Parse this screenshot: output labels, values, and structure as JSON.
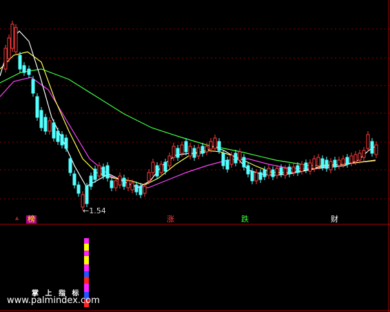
{
  "chart_data": [
    {
      "type": "candlestick",
      "panel": "price",
      "annotation": {
        "text": "←1.54",
        "value": 1.54
      },
      "colors": {
        "up": "#ff3b3b",
        "down": "#54ffff",
        "ma5": "#ffffff",
        "ma10": "#ffff55",
        "ma20": "#ff44ff",
        "ma60": "#44ff44"
      },
      "grid": true,
      "signals": [
        {
          "text": "榜",
          "color": "#ffff00",
          "bg": "#b0008f"
        },
        {
          "text": "涨",
          "color": "#ff3b3b",
          "bg": "#000000"
        },
        {
          "text": "跌",
          "color": "#33ff33",
          "bg": "#000000"
        },
        {
          "text": "财",
          "color": "#ffffff",
          "bg": "#000000"
        }
      ]
    },
    {
      "type": "bar",
      "panel": "indicator",
      "colors": [
        "#ff22ff",
        "#ffff00",
        "#ff2222",
        "#2255ff"
      ]
    }
  ],
  "watermark": {
    "title": "掌 上 指 标",
    "url": "www.palmindex.com"
  }
}
